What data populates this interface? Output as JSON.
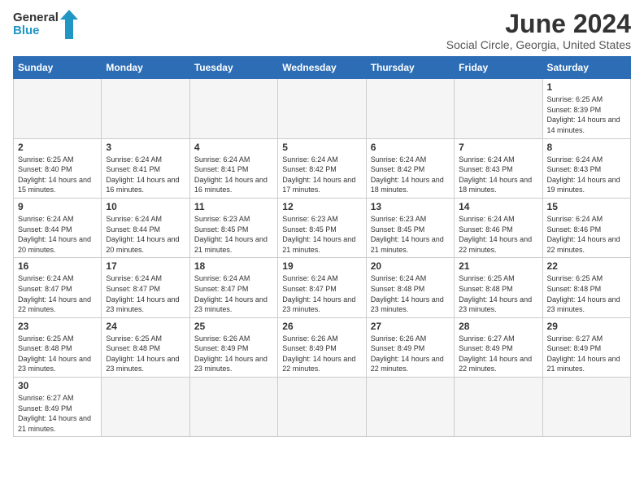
{
  "header": {
    "logo_general": "General",
    "logo_blue": "Blue",
    "title": "June 2024",
    "subtitle": "Social Circle, Georgia, United States"
  },
  "weekdays": [
    "Sunday",
    "Monday",
    "Tuesday",
    "Wednesday",
    "Thursday",
    "Friday",
    "Saturday"
  ],
  "weeks": [
    [
      {
        "day": "",
        "empty": true
      },
      {
        "day": "",
        "empty": true
      },
      {
        "day": "",
        "empty": true
      },
      {
        "day": "",
        "empty": true
      },
      {
        "day": "",
        "empty": true
      },
      {
        "day": "",
        "empty": true
      },
      {
        "day": "1",
        "sunrise": "6:25 AM",
        "sunset": "8:39 PM",
        "daylight": "14 hours and 14 minutes."
      }
    ],
    [
      {
        "day": "2",
        "sunrise": "6:25 AM",
        "sunset": "8:40 PM",
        "daylight": "14 hours and 15 minutes."
      },
      {
        "day": "3",
        "sunrise": "6:24 AM",
        "sunset": "8:41 PM",
        "daylight": "14 hours and 16 minutes."
      },
      {
        "day": "4",
        "sunrise": "6:24 AM",
        "sunset": "8:41 PM",
        "daylight": "14 hours and 16 minutes."
      },
      {
        "day": "5",
        "sunrise": "6:24 AM",
        "sunset": "8:42 PM",
        "daylight": "14 hours and 17 minutes."
      },
      {
        "day": "6",
        "sunrise": "6:24 AM",
        "sunset": "8:42 PM",
        "daylight": "14 hours and 18 minutes."
      },
      {
        "day": "7",
        "sunrise": "6:24 AM",
        "sunset": "8:43 PM",
        "daylight": "14 hours and 18 minutes."
      },
      {
        "day": "8",
        "sunrise": "6:24 AM",
        "sunset": "8:43 PM",
        "daylight": "14 hours and 19 minutes."
      }
    ],
    [
      {
        "day": "9",
        "sunrise": "6:24 AM",
        "sunset": "8:44 PM",
        "daylight": "14 hours and 20 minutes."
      },
      {
        "day": "10",
        "sunrise": "6:24 AM",
        "sunset": "8:44 PM",
        "daylight": "14 hours and 20 minutes."
      },
      {
        "day": "11",
        "sunrise": "6:23 AM",
        "sunset": "8:45 PM",
        "daylight": "14 hours and 21 minutes."
      },
      {
        "day": "12",
        "sunrise": "6:23 AM",
        "sunset": "8:45 PM",
        "daylight": "14 hours and 21 minutes."
      },
      {
        "day": "13",
        "sunrise": "6:23 AM",
        "sunset": "8:45 PM",
        "daylight": "14 hours and 21 minutes."
      },
      {
        "day": "14",
        "sunrise": "6:24 AM",
        "sunset": "8:46 PM",
        "daylight": "14 hours and 22 minutes."
      },
      {
        "day": "15",
        "sunrise": "6:24 AM",
        "sunset": "8:46 PM",
        "daylight": "14 hours and 22 minutes."
      }
    ],
    [
      {
        "day": "16",
        "sunrise": "6:24 AM",
        "sunset": "8:47 PM",
        "daylight": "14 hours and 22 minutes."
      },
      {
        "day": "17",
        "sunrise": "6:24 AM",
        "sunset": "8:47 PM",
        "daylight": "14 hours and 23 minutes."
      },
      {
        "day": "18",
        "sunrise": "6:24 AM",
        "sunset": "8:47 PM",
        "daylight": "14 hours and 23 minutes."
      },
      {
        "day": "19",
        "sunrise": "6:24 AM",
        "sunset": "8:47 PM",
        "daylight": "14 hours and 23 minutes."
      },
      {
        "day": "20",
        "sunrise": "6:24 AM",
        "sunset": "8:48 PM",
        "daylight": "14 hours and 23 minutes."
      },
      {
        "day": "21",
        "sunrise": "6:25 AM",
        "sunset": "8:48 PM",
        "daylight": "14 hours and 23 minutes."
      },
      {
        "day": "22",
        "sunrise": "6:25 AM",
        "sunset": "8:48 PM",
        "daylight": "14 hours and 23 minutes."
      }
    ],
    [
      {
        "day": "23",
        "sunrise": "6:25 AM",
        "sunset": "8:48 PM",
        "daylight": "14 hours and 23 minutes."
      },
      {
        "day": "24",
        "sunrise": "6:25 AM",
        "sunset": "8:48 PM",
        "daylight": "14 hours and 23 minutes."
      },
      {
        "day": "25",
        "sunrise": "6:26 AM",
        "sunset": "8:49 PM",
        "daylight": "14 hours and 23 minutes."
      },
      {
        "day": "26",
        "sunrise": "6:26 AM",
        "sunset": "8:49 PM",
        "daylight": "14 hours and 22 minutes."
      },
      {
        "day": "27",
        "sunrise": "6:26 AM",
        "sunset": "8:49 PM",
        "daylight": "14 hours and 22 minutes."
      },
      {
        "day": "28",
        "sunrise": "6:27 AM",
        "sunset": "8:49 PM",
        "daylight": "14 hours and 22 minutes."
      },
      {
        "day": "29",
        "sunrise": "6:27 AM",
        "sunset": "8:49 PM",
        "daylight": "14 hours and 21 minutes."
      }
    ],
    [
      {
        "day": "30",
        "sunrise": "6:27 AM",
        "sunset": "8:49 PM",
        "daylight": "14 hours and 21 minutes."
      },
      {
        "day": "",
        "empty": true
      },
      {
        "day": "",
        "empty": true
      },
      {
        "day": "",
        "empty": true
      },
      {
        "day": "",
        "empty": true
      },
      {
        "day": "",
        "empty": true
      },
      {
        "day": "",
        "empty": true
      }
    ]
  ],
  "labels": {
    "sunrise": "Sunrise:",
    "sunset": "Sunset:",
    "daylight": "Daylight:"
  }
}
